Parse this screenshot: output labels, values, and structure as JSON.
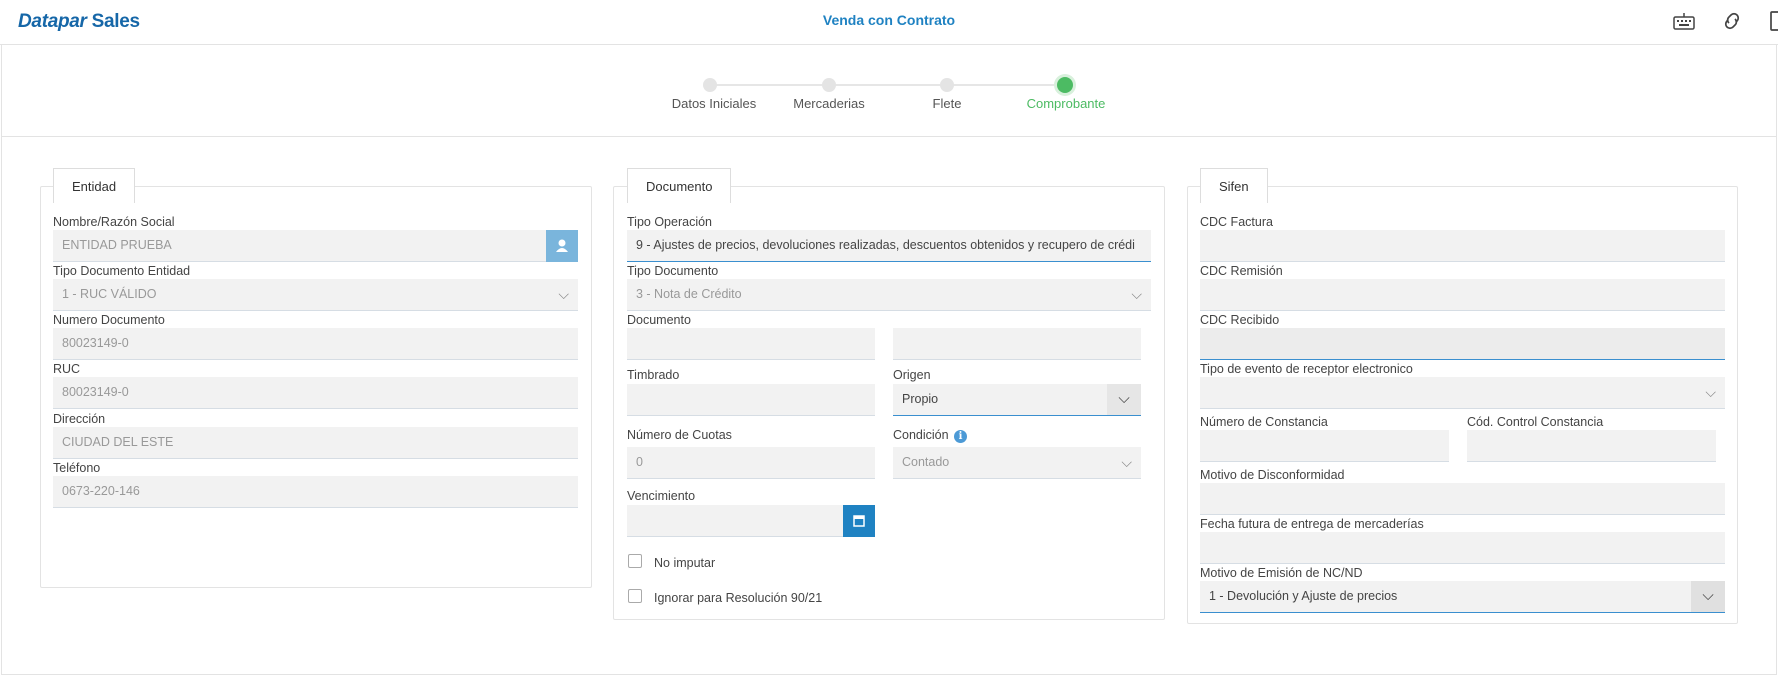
{
  "header": {
    "brand_part1": "Datapar",
    "brand_part2": "Sales",
    "title": "Venda con Contrato",
    "icons": [
      "keyboard-icon",
      "link-icon",
      "document-icon"
    ]
  },
  "wizard": {
    "steps": [
      {
        "label": "Datos Iniciales",
        "active": false
      },
      {
        "label": "Mercaderias",
        "active": false
      },
      {
        "label": "Flete",
        "active": false
      },
      {
        "label": "Comprobante",
        "active": true
      }
    ]
  },
  "entidad": {
    "legend": "Entidad",
    "nombre_label": "Nombre/Razón Social",
    "nombre_value": "ENTIDAD PRUEBA",
    "tipo_doc_label": "Tipo Documento Entidad",
    "tipo_doc_value": "1 - RUC VÁLIDO",
    "numero_label": "Numero Documento",
    "numero_value": "80023149-0",
    "ruc_label": "RUC",
    "ruc_value": "80023149-0",
    "direccion_label": "Dirección",
    "direccion_value": "CIUDAD DEL ESTE",
    "telefono_label": "Teléfono",
    "telefono_value": "0673-220-146"
  },
  "documento": {
    "legend": "Documento",
    "tipo_operacion_label": "Tipo Operación",
    "tipo_operacion_value": "9 - Ajustes de precios, devoluciones realizadas, descuentos obtenidos y recupero de crédi",
    "tipo_documento_label": "Tipo Documento",
    "tipo_documento_value": "3 - Nota de Crédito",
    "documento_label": "Documento",
    "documento_value_1": "",
    "documento_value_2": "",
    "timbrado_label": "Timbrado",
    "timbrado_value": "",
    "origen_label": "Origen",
    "origen_value": "Propio",
    "cuotas_label": "Número de Cuotas",
    "cuotas_value": "0",
    "condicion_label": "Condición",
    "condicion_value": "Contado",
    "vencimiento_label": "Vencimiento",
    "vencimiento_value": "",
    "no_imputar_label": "No imputar",
    "no_imputar_checked": false,
    "ignorar_label": "Ignorar para Resolución 90/21",
    "ignorar_checked": false
  },
  "sifen": {
    "legend": "Sifen",
    "cdc_factura_label": "CDC Factura",
    "cdc_factura_value": "",
    "cdc_remision_label": "CDC Remisión",
    "cdc_remision_value": "",
    "cdc_recibido_label": "CDC Recibido",
    "cdc_recibido_value": "",
    "tipo_evento_label": "Tipo de evento de receptor electronico",
    "tipo_evento_value": "",
    "numero_constancia_label": "Número de Constancia",
    "numero_constancia_value": "",
    "cod_control_label": "Cód. Control Constancia",
    "cod_control_value": "",
    "motivo_disconf_label": "Motivo de Disconformidad",
    "motivo_disconf_value": "",
    "fecha_futura_label": "Fecha futura de entrega de mercaderías",
    "fecha_futura_value": "",
    "motivo_emision_label": "Motivo de Emisión de NC/ND",
    "motivo_emision_value": "1 - Devolución y Ajuste de precios"
  },
  "colors": {
    "accent": "#1f82c2",
    "active_step": "#4cbb63",
    "field_bg": "#f2f2f2"
  }
}
